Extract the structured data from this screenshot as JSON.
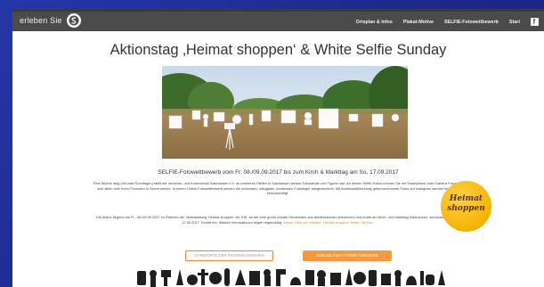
{
  "colors": {
    "nav_bg": "#4b4b4b",
    "accent": "#f39a3e",
    "badge": "#f4b300",
    "frame": "#1d2b8f"
  },
  "nav": {
    "brand": "erleben Sie",
    "links": [
      "Ortsplan & Infos",
      "Plakat-Motive",
      "SELFIE-Fotowettbewerb",
      "Start"
    ],
    "icons": [
      "logo-icon",
      "facebook-icon"
    ]
  },
  "page": {
    "title": "Aktionstag ‚Heimat shoppen‘ & White Selfie Sunday",
    "heading": "SELFIE-Fotowettbewerb vom Fr. 08./09.09.2017 bis zum Kirch & Markttag am So. 17.09.2017",
    "para1": "Eine Woche lang (mit zwei Sonntagen) stellt der Verkehrs- und Kulturverein Salzhausen e.V. an mehreren Stellen in Salzhausen weisse Fotowände und Figuren auf. An diesen Selfie-Points können Sie mit Smartphone oder Kamera Fotos mit sich allein oder ihren Freunden in Szene setzen. In einem Online-Fotowettbewerb werden die schönsten, witzigsten, kreativsten Fotosieger ausgezeichnet. Mit #whitesselfiesunday gekennzeichnete Fotos auf Instagram werden ebenfalls berücksichtigt.",
    "para2": "Die Aktion beginnt am Fr., 08./09.09.2017 im Rahmen der Veranstaltung 'Heimat shoppen' der IHK, an der eine große Anzahl Gemeinden aus Niedersachsen teilnehmen und endet am Kirch- und Markttag Salzhausen, verkaufsoffener So. 17.09.2017. Eintritt frei. Weitere Informationen folgen regelmäßig.",
    "para2_link": "Weiter Infos zur Initiative „Heimat shoppen“ finden Sie hier.",
    "badge_line1": "Heimat",
    "badge_line2": "shoppen",
    "btn_locations": "STANDORTE DER FIGUREN ANSEHEN",
    "btn_contest": "ZUM SELFIE-FOTOWETTBEWERB"
  }
}
